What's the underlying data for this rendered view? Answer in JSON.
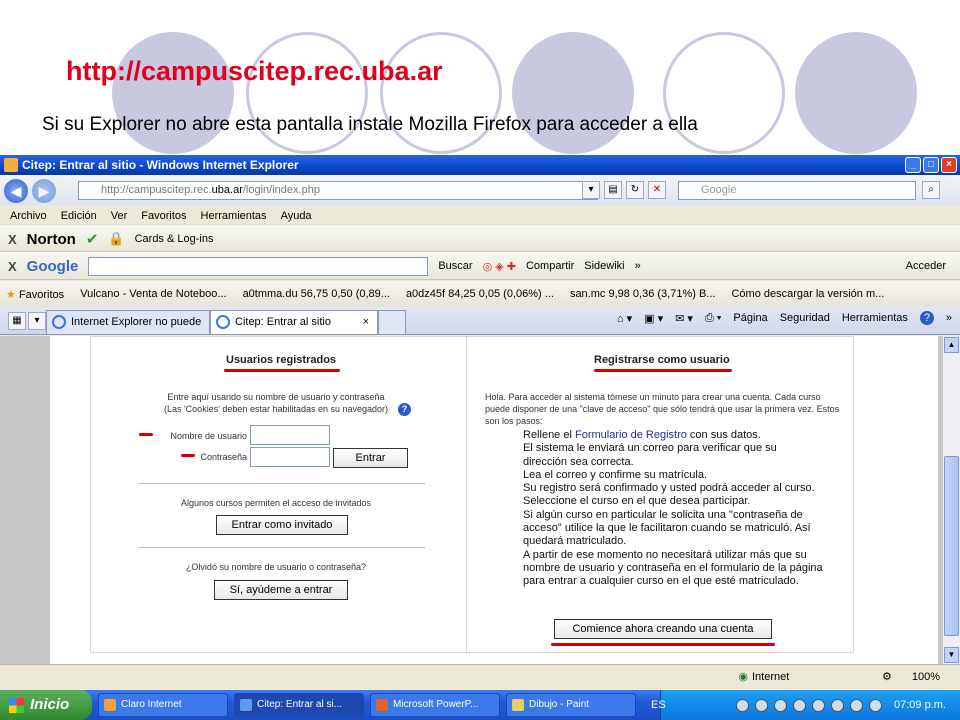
{
  "slide": {
    "url": "http://campuscitep.rec.uba.ar",
    "note": "Si su Explorer no abre esta pantalla instale Mozilla Firefox para acceder a ella"
  },
  "window": {
    "title": "Citep: Entrar al sitio - Windows Internet Explorer"
  },
  "address": {
    "prefix": "http://campuscitep.rec.",
    "domain": "uba.ar",
    "path": "/login/index.php"
  },
  "search": {
    "placeholder": "Google"
  },
  "menu": [
    "Archivo",
    "Edición",
    "Ver",
    "Favoritos",
    "Herramientas",
    "Ayuda"
  ],
  "norton": {
    "brand": "Norton",
    "cards": "Cards & Log-ins"
  },
  "googlebar": {
    "brand": "Google",
    "buscar": "Buscar",
    "compartir": "Compartir",
    "sidewiki": "Sidewiki",
    "acceder": "Acceder"
  },
  "favorites": {
    "label": "Favoritos",
    "items": [
      "Vulcano - Venta de Noteboo...",
      "a0tmma.du 56,75 0,50 (0,89...",
      "a0dz45f 84,25 0,05 (0,06%) ...",
      "san.mc 9,98 0,36 (3,71%)  B...",
      "Cómo descargar la versión m..."
    ]
  },
  "tabs": [
    {
      "label": "Internet Explorer no puede mo..."
    },
    {
      "label": "Citep: Entrar al sitio"
    }
  ],
  "commandbar": {
    "pagina": "Página",
    "seguridad": "Seguridad",
    "herramientas": "Herramientas"
  },
  "login": {
    "heading": "Usuarios registrados",
    "intro1": "Entre aquí usando su nombre de usuario y contraseña",
    "intro2": "(Las 'Cookies' deben estar habilitadas en su navegador)",
    "user_label": "Nombre de usuario",
    "pass_label": "Contraseña",
    "enter": "Entrar",
    "guest_text": "Algunos cursos permiten el acceso de invitados",
    "guest_btn": "Entrar como invitado",
    "forgot_text": "¿Olvidó su nombre de usuario o contraseña?",
    "forgot_btn": "Sí, ayúdeme a entrar"
  },
  "register": {
    "heading": "Registrarse como usuario",
    "intro": "Hola. Para acceder al sistema tómese un minuto para crear una cuenta. Cada curso puede disponer de una \"clave de acceso\" que sólo tendrá que usar la primera vez. Estos son los pasos:",
    "step1a": "Rellene el ",
    "step1link": "Formulario de Registro",
    "step1b": " con sus datos.",
    "step2": "El sistema le enviará un correo para verificar que su dirección sea correcta.",
    "step3": "Lea el correo y confirme su matrícula.",
    "step4": "Su registro será confirmado y usted podrá acceder al curso.",
    "step5": "Seleccione el curso en el que desea participar.",
    "step6": "Si algún curso en particular le solicita una \"contraseña de acceso\" utilice la que le facilitaron cuando se matriculó. Así quedará matriculado.",
    "step7": "A partir de ese momento no necesitará utilizar más que su nombre de usuario y contraseña en el formulario de la página para entrar a cualquier curso en el que esté matriculado.",
    "button": "Comience ahora creando una cuenta"
  },
  "status": {
    "zone": "Internet",
    "zoom": "100%"
  },
  "taskbar": {
    "start": "Inicio",
    "items": [
      "Claro Internet",
      "Citep: Entrar al si...",
      "Microsoft PowerP...",
      "Dibujo - Paint"
    ],
    "lang": "ES",
    "clock": "07:09 p.m."
  },
  "colors": {
    "url_red": "#e0001e",
    "annotation_red": "#d40000",
    "circles": "#c8c8e0"
  }
}
